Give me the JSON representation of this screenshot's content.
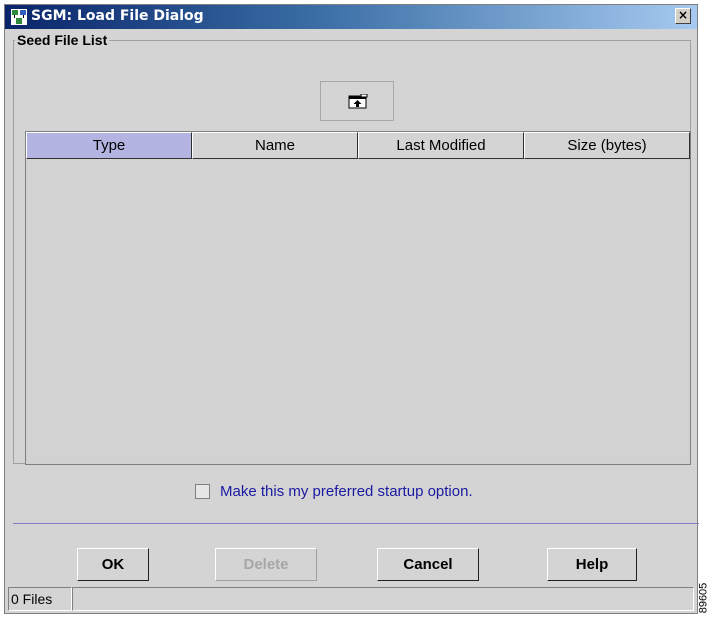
{
  "window": {
    "title": "SGM: Load File Dialog",
    "close_glyph": "×",
    "title_icon": "app-network-icon"
  },
  "group": {
    "title": "Seed File List"
  },
  "toolbar": {
    "upload_icon": "upload-file-icon"
  },
  "table": {
    "columns": [
      "Type",
      "Name",
      "Last Modified",
      "Size (bytes)"
    ],
    "selected_column": "Type",
    "rows": []
  },
  "preference": {
    "label": "Make this my preferred startup option.",
    "checked": false
  },
  "buttons": {
    "ok": "OK",
    "delete": "Delete",
    "cancel": "Cancel",
    "help": "Help"
  },
  "status": {
    "count": "0 Files",
    "message": ""
  },
  "side_label": "89605",
  "colors": {
    "accent": "#0a246a",
    "selected_header": "#b4b4e2",
    "link_text": "#1a1aa0"
  }
}
